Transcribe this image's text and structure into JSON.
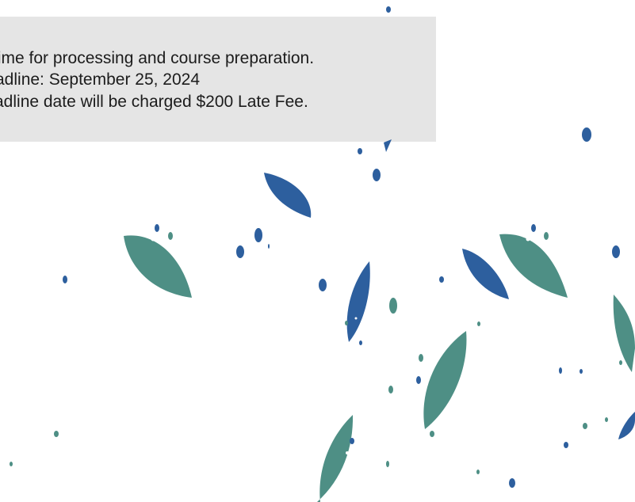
{
  "notice": {
    "line1": "time for processing and course preparation.",
    "line2": "adline: September 25, 2024",
    "line3": "adline date will be charged $200 Late Fee."
  },
  "decoration": {
    "blue": "#2d5f9e",
    "teal": "#4e8f85"
  }
}
